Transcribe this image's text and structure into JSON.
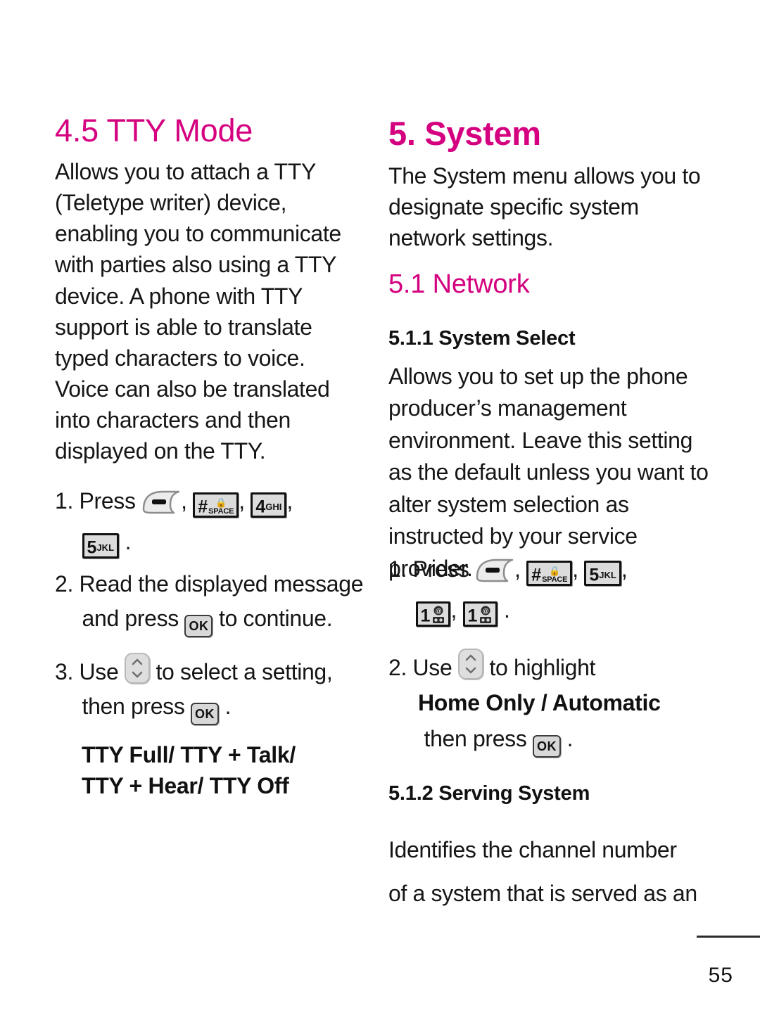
{
  "document": {
    "page_number": "55"
  },
  "left_column": {
    "heading": "4.5 TTY Mode",
    "intro": "Allows you to attach a TTY (Teletype writer) device, enabling you to communicate with parties also using a TTY device. A phone with TTY support is able to translate typed characters to voice. Voice can also be translated into characters and then displayed on the TTY.",
    "steps": [
      {
        "number": "1.",
        "text_before": "Press",
        "keys": [
          "end-key",
          "hash-space-key",
          "4-ghi-key",
          "5-jkl-key"
        ],
        "text_after": "."
      },
      {
        "number": "2.",
        "part1": "Read the displayed message",
        "part2": "and press",
        "key": "ok-key",
        "part3": "to continue."
      },
      {
        "number": "3.",
        "part1": "Use",
        "key1": "nav-key",
        "part2": "to select a setting,",
        "part3": "then press",
        "key2": "ok-key",
        "part4": "."
      }
    ],
    "options_line1": "TTY Full/ TTY + Talk/",
    "options_line2": "TTY + Hear/ TTY Off"
  },
  "right_column": {
    "heading": "5. System",
    "intro": "The System menu allows you to designate specific system network settings.",
    "section_heading": "5.1 Network",
    "subsection_1": {
      "heading": "5.1.1 System Select",
      "body": "Allows you to set up the phone producer’s management environment. Leave this setting as the default unless you want to alter system selection as instructed by your service provider.",
      "steps": [
        {
          "number": "1.",
          "text_before": "Press",
          "keys": [
            "end-key",
            "hash-space-key",
            "5-jkl-key",
            "1-at-key",
            "1-at-key"
          ],
          "text_after": "."
        },
        {
          "number": "2.",
          "part1": "Use",
          "key1": "nav-key",
          "part2": "to highlight",
          "bold_options": "Home Only / Automatic",
          "part3": "then press",
          "key2": "ok-key",
          "part4": "."
        }
      ]
    },
    "subsection_2": {
      "heading": "5.1.2 Serving System",
      "body_line1": "Identifies the channel number",
      "body_line2": "of a system that is served as an"
    }
  },
  "keys": {
    "hash_symbol": "#",
    "space_label": "SPACE",
    "lock_glyph": "🔒",
    "four_digit": "4",
    "four_letters": "GHI",
    "five_digit": "5",
    "five_letters": "JKL",
    "one_digit": "1",
    "at_symbol": "@",
    "ok_label": "OK"
  },
  "colors": {
    "accent_pink": "#D4007F",
    "text": "#161616",
    "key_fill": "#DCDCDC",
    "key_border": "#111111"
  }
}
